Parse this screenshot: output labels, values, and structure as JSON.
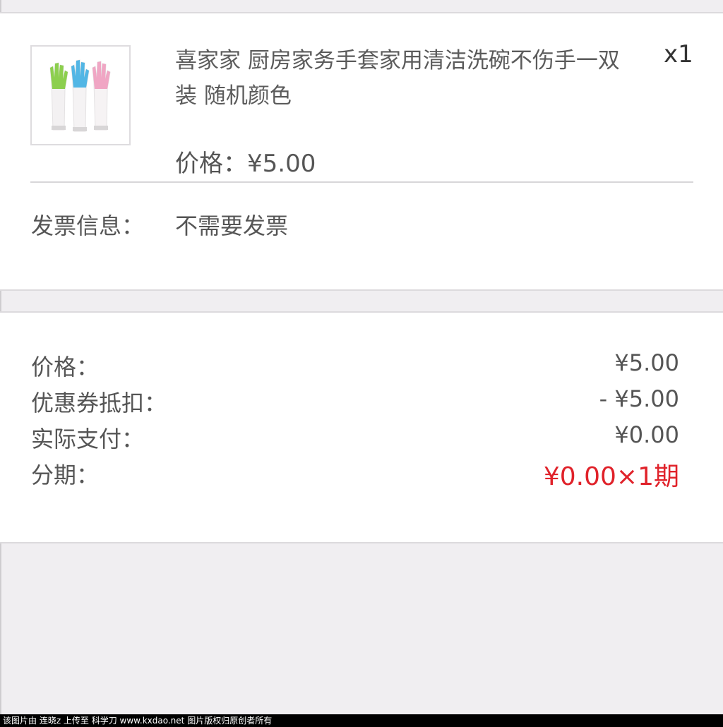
{
  "product": {
    "image_icon": "rubber-gloves-image",
    "title": "喜家家 厨房家务手套家用清洁洗碗不伤手一双装 随机颜色",
    "quantity": "x1",
    "price_label": "价格：",
    "price_value": "¥5.00"
  },
  "invoice": {
    "label": "发票信息：",
    "value": "不需要发票"
  },
  "summary": {
    "rows": [
      {
        "label": "价格：",
        "value": "¥5.00"
      },
      {
        "label": "优惠券抵扣：",
        "value": "- ¥5.00"
      },
      {
        "label": "实际支付：",
        "value": "¥0.00"
      },
      {
        "label": "分期：",
        "value": "¥0.00×1期"
      }
    ]
  },
  "colors": {
    "accent_red": "#e0222a",
    "text_gray": "#555555",
    "background": "#f0eef1"
  },
  "watermark": "该图片由 连晓z 上传至 科学刀 www.kxdao.net 图片版权归原创者所有"
}
